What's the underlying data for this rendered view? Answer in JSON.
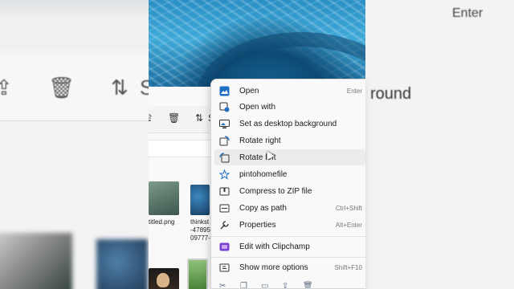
{
  "background": {
    "right_enter": "Enter",
    "right_round": "round",
    "left_toolbar_partial": "S"
  },
  "explorer": {
    "toolbar": {
      "partial_label": "S"
    },
    "files": [
      {
        "caption": "titled.png"
      },
      {
        "caption": "thinkst\n-47895\n09777-"
      }
    ]
  },
  "context_menu": {
    "items": [
      {
        "label": "Open",
        "shortcut": "Enter",
        "icon": "image-icon"
      },
      {
        "label": "Open with",
        "shortcut": "",
        "icon": "open-with-icon"
      },
      {
        "label": "Set as desktop background",
        "shortcut": "",
        "icon": "desktop-background-icon"
      },
      {
        "label": "Rotate right",
        "shortcut": "",
        "icon": "rotate-right-icon"
      },
      {
        "label": "Rotate left",
        "shortcut": "",
        "icon": "rotate-left-icon"
      },
      {
        "label": "pintohomefile",
        "shortcut": "",
        "icon": "star-icon"
      },
      {
        "label": "Compress to ZIP file",
        "shortcut": "",
        "icon": "zip-folder-icon"
      },
      {
        "label": "Copy as path",
        "shortcut": "Ctrl+Shift",
        "icon": "copy-path-icon"
      },
      {
        "label": "Properties",
        "shortcut": "Alt+Enter",
        "icon": "wrench-icon"
      },
      {
        "label": "Edit with Clipchamp",
        "shortcut": "",
        "icon": "clipchamp-icon"
      },
      {
        "label": "Show more options",
        "shortcut": "Shift+F10",
        "icon": "more-options-icon"
      }
    ],
    "hovered_item": "Rotate left",
    "bottom_icons": [
      "cut-icon",
      "copy-icon",
      "rename-icon",
      "share-icon",
      "delete-icon"
    ]
  },
  "colors": {
    "menu_bg": "#f9f9f9",
    "accent": "#1d5fa8",
    "clipchamp": "#7a3fd1",
    "hover": "#ececec"
  }
}
